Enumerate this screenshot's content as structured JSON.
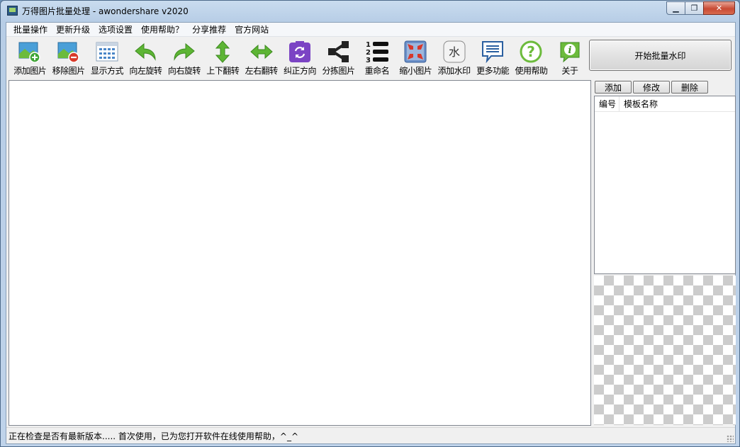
{
  "window": {
    "title": "万得图片批量处理 - awondershare v2020"
  },
  "menu": [
    "批量操作",
    "更新升级",
    "选项设置",
    "使用帮助？",
    "分享推荐",
    "官方网站"
  ],
  "toolbar": {
    "items": [
      {
        "label": "添加图片",
        "icon": "add-image-icon"
      },
      {
        "label": "移除图片",
        "icon": "remove-image-icon"
      },
      {
        "label": "显示方式",
        "icon": "grid-view-icon"
      },
      {
        "label": "向左旋转",
        "icon": "rotate-left-icon"
      },
      {
        "label": "向右旋转",
        "icon": "rotate-right-icon"
      },
      {
        "label": "上下翻转",
        "icon": "flip-vertical-icon"
      },
      {
        "label": "左右翻转",
        "icon": "flip-horizontal-icon"
      },
      {
        "label": "纠正方向",
        "icon": "correct-orientation-icon"
      },
      {
        "label": "分拣图片",
        "icon": "share-sort-icon"
      },
      {
        "label": "重命名",
        "icon": "numbered-list-icon"
      },
      {
        "label": "缩小图片",
        "icon": "shrink-icon"
      },
      {
        "label": "添加水印",
        "icon": "watermark-icon"
      },
      {
        "label": "更多功能",
        "icon": "more-functions-icon"
      },
      {
        "label": "使用帮助",
        "icon": "help-icon"
      },
      {
        "label": "关于",
        "icon": "info-icon"
      }
    ],
    "start_label": "开始批量水印"
  },
  "side": {
    "buttons": {
      "add": "添加",
      "edit": "修改",
      "delete": "删除"
    },
    "columns": {
      "number": "编号",
      "name": "模板名称"
    }
  },
  "status": {
    "text": "正在检查是否有最新版本..... 首次使用，已为您打开软件在线使用帮助，^_^"
  },
  "colors": {
    "accent_green": "#6cbb3c",
    "purple": "#7b44c4",
    "titlebar": "#c9dcef"
  }
}
